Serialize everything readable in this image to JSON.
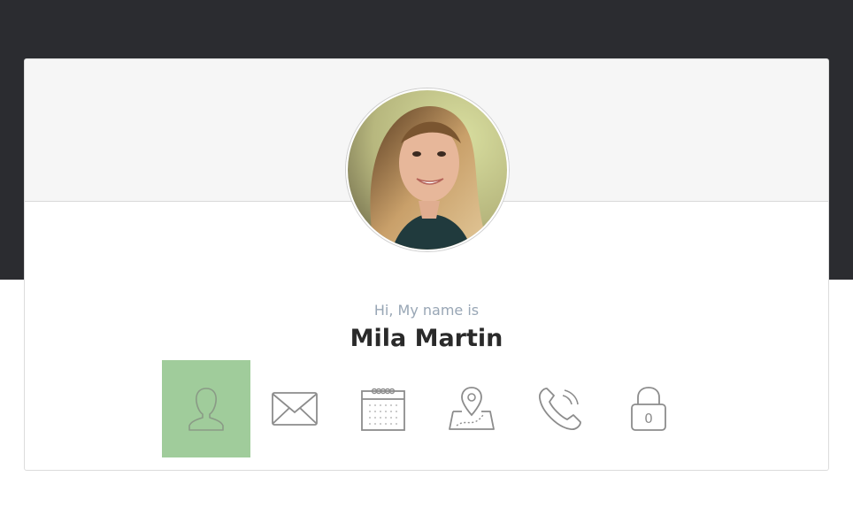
{
  "profile": {
    "greeting": "Hi, My name is",
    "name": "Mila Martin",
    "avatar_alt": "portrait photo"
  },
  "icons": [
    {
      "name": "user-icon",
      "active": true
    },
    {
      "name": "mail-icon",
      "active": false
    },
    {
      "name": "calendar-icon",
      "active": false
    },
    {
      "name": "map-icon",
      "active": false
    },
    {
      "name": "phone-icon",
      "active": false
    },
    {
      "name": "lock-icon",
      "active": false
    }
  ],
  "lock_digit": "0",
  "colors": {
    "top_band": "#2b2c30",
    "active_tab": "#a0cc9b",
    "greeting_text": "#98a6b5",
    "icon_stroke": "#8c8c8c"
  }
}
